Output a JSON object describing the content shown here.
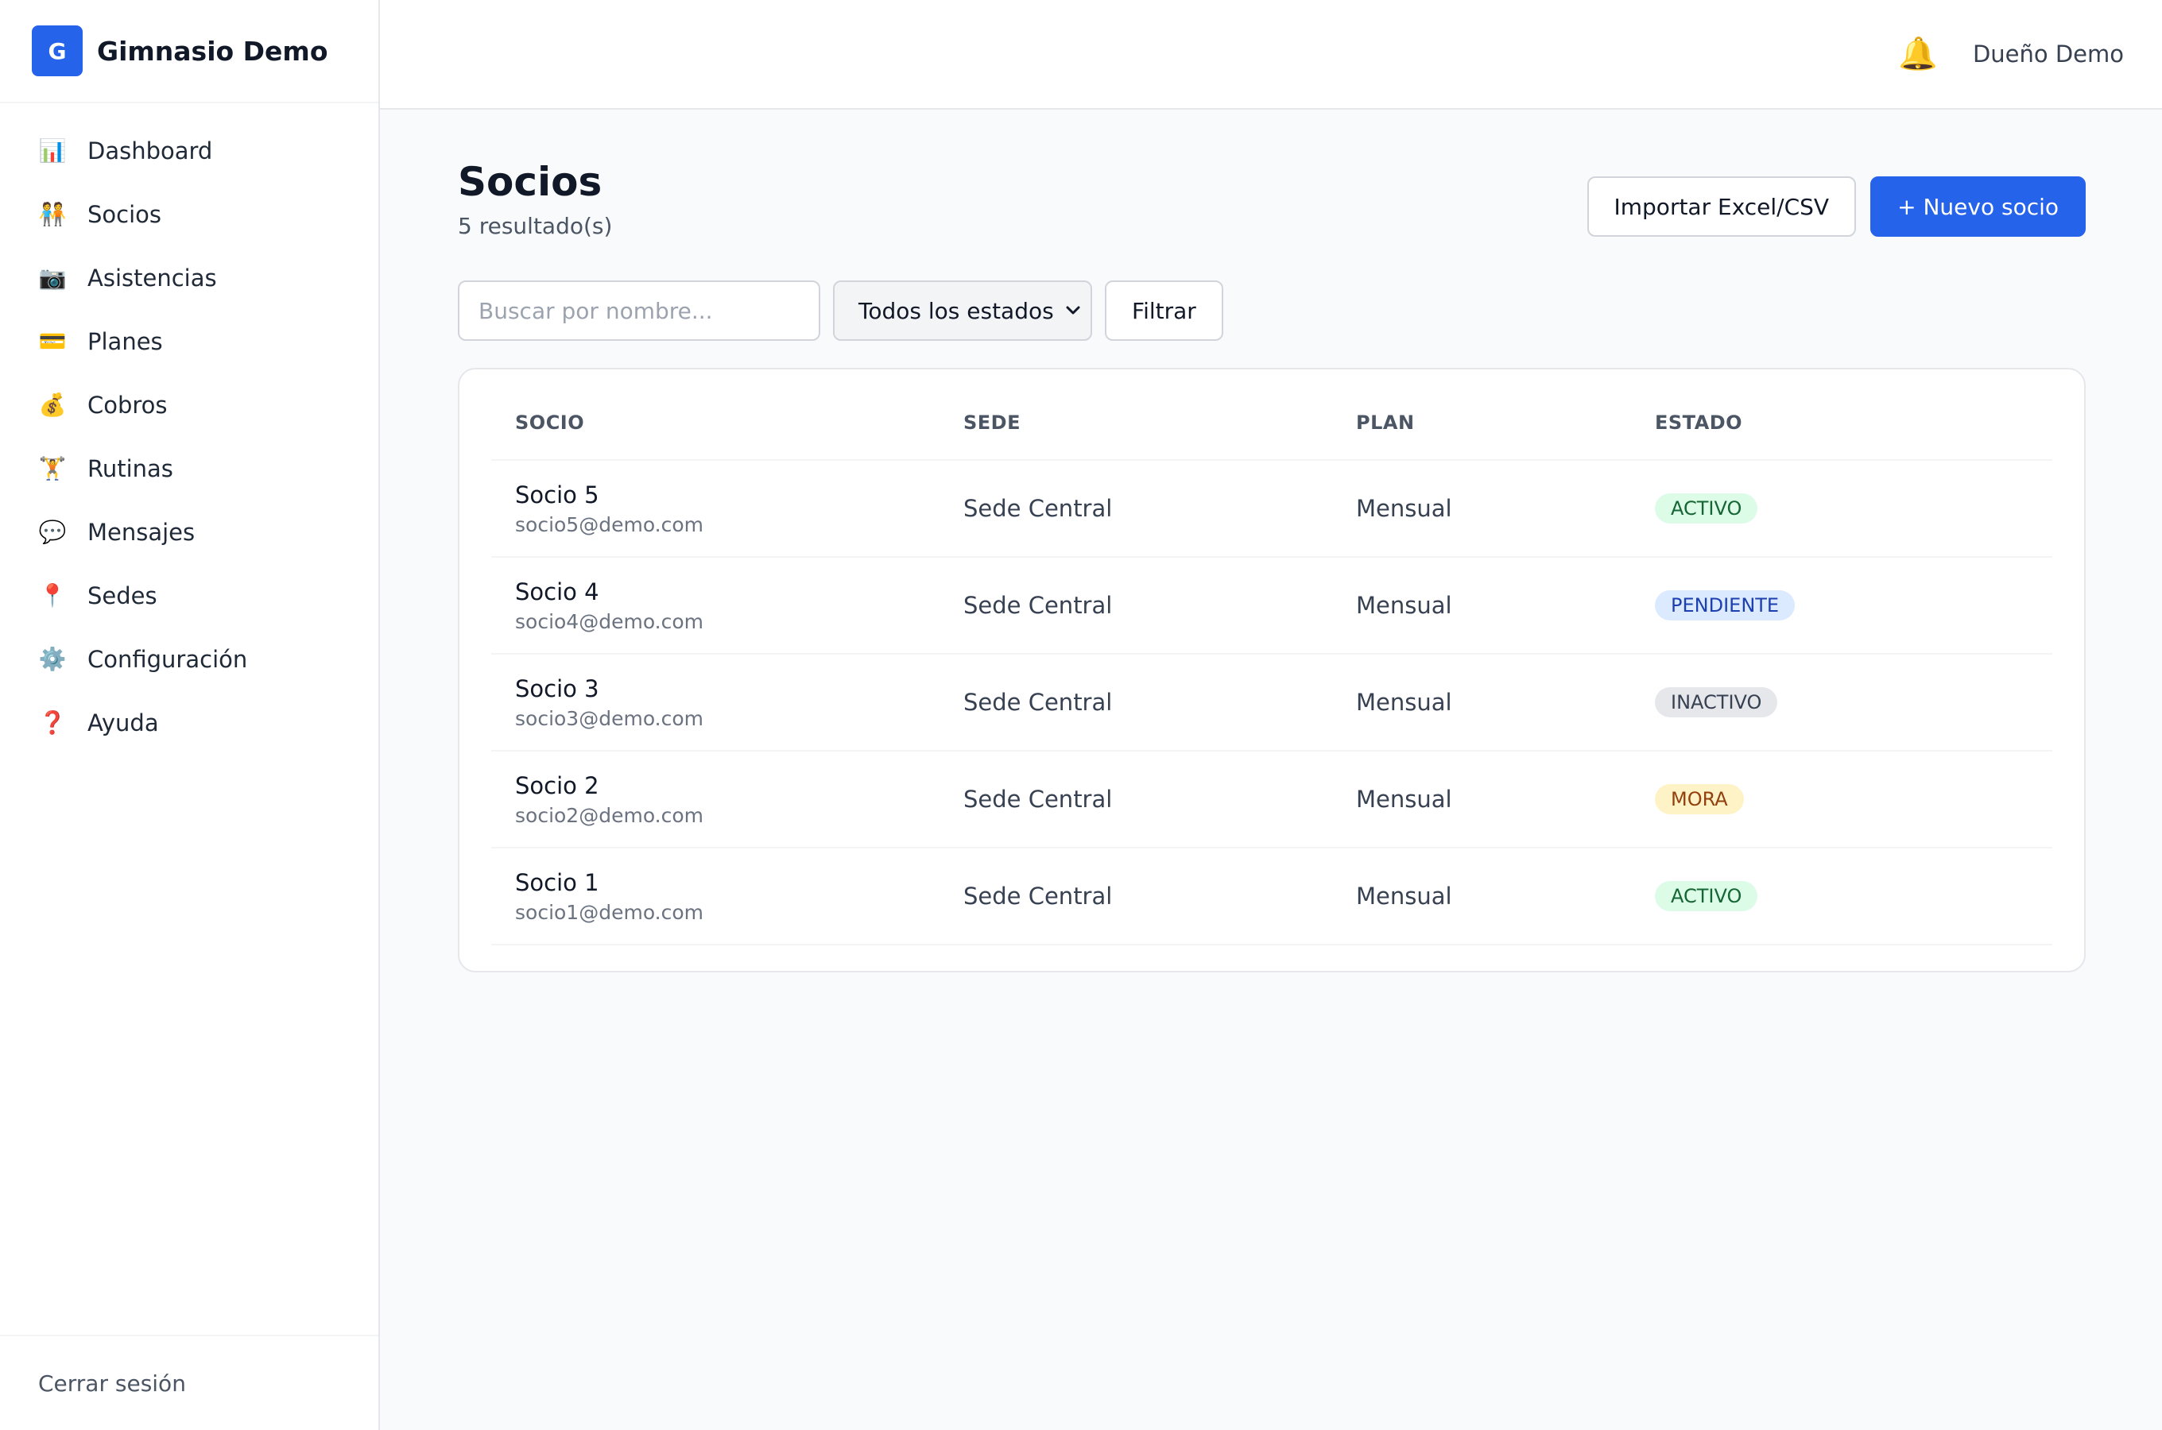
{
  "brand": {
    "logo_letter": "G",
    "name": "Gimnasio Demo"
  },
  "sidebar": {
    "items": [
      {
        "label": "Dashboard",
        "icon": "chart-icon",
        "glyph": "📊"
      },
      {
        "label": "Socios",
        "icon": "people-icon",
        "glyph": "🧑‍🤝‍🧑"
      },
      {
        "label": "Asistencias",
        "icon": "camera-icon",
        "glyph": "📷"
      },
      {
        "label": "Planes",
        "icon": "credit-card-icon",
        "glyph": "💳"
      },
      {
        "label": "Cobros",
        "icon": "money-bag-icon",
        "glyph": "💰"
      },
      {
        "label": "Rutinas",
        "icon": "weightlifter-icon",
        "glyph": "🏋️"
      },
      {
        "label": "Mensajes",
        "icon": "speech-bubble-icon",
        "glyph": "💬"
      },
      {
        "label": "Sedes",
        "icon": "pin-icon",
        "glyph": "📍"
      },
      {
        "label": "Configuración",
        "icon": "gear-icon",
        "glyph": "⚙️"
      },
      {
        "label": "Ayuda",
        "icon": "question-icon",
        "glyph": "❓"
      }
    ],
    "logout_label": "Cerrar sesión"
  },
  "topbar": {
    "bell_glyph": "🔔",
    "user_name": "Dueño Demo"
  },
  "page": {
    "title": "Socios",
    "subtitle": "5 resultado(s)",
    "import_label": "Importar Excel/CSV",
    "new_label": "+ Nuevo socio"
  },
  "filters": {
    "search_placeholder": "Buscar por nombre...",
    "status_selected": "Todos los estados",
    "filter_label": "Filtrar"
  },
  "table": {
    "headers": [
      "SOCIO",
      "SEDE",
      "PLAN",
      "ESTADO"
    ],
    "rows": [
      {
        "name": "Socio 5",
        "email": "socio5@demo.com",
        "sede": "Sede Central",
        "plan": "Mensual",
        "estado": "ACTIVO",
        "kind": "activo"
      },
      {
        "name": "Socio 4",
        "email": "socio4@demo.com",
        "sede": "Sede Central",
        "plan": "Mensual",
        "estado": "PENDIENTE",
        "kind": "pendiente"
      },
      {
        "name": "Socio 3",
        "email": "socio3@demo.com",
        "sede": "Sede Central",
        "plan": "Mensual",
        "estado": "INACTIVO",
        "kind": "inactivo"
      },
      {
        "name": "Socio 2",
        "email": "socio2@demo.com",
        "sede": "Sede Central",
        "plan": "Mensual",
        "estado": "MORA",
        "kind": "mora"
      },
      {
        "name": "Socio 1",
        "email": "socio1@demo.com",
        "sede": "Sede Central",
        "plan": "Mensual",
        "estado": "ACTIVO",
        "kind": "activo"
      }
    ]
  },
  "colors": {
    "primary": "#2563eb",
    "activo_bg": "#dcfce7",
    "pendiente_bg": "#dbeafe",
    "inactivo_bg": "#e5e7eb",
    "mora_bg": "#fef3c7"
  }
}
